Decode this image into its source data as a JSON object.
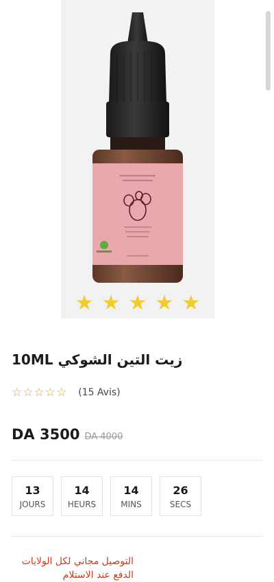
{
  "product": {
    "title": "زيت التين الشوكي 10ML",
    "rating_count": "(15 Avis)",
    "rating_stars": "☆☆☆☆☆",
    "price": "DA 3500",
    "old_price": "DA 4000",
    "image_stars": 5
  },
  "countdown": [
    {
      "value": "13",
      "label": "JOURS"
    },
    {
      "value": "14",
      "label": "HEURS"
    },
    {
      "value": "14",
      "label": "MINS"
    },
    {
      "value": "26",
      "label": "SECS"
    }
  ],
  "promo": {
    "line1": "التوصيل مجاني لكل الولايات",
    "line2": "الدفع عند الاستلام"
  },
  "colors": {
    "accent_red": "#d2381b",
    "star_yellow": "#f2cb2c",
    "label_pink": "#e9a7ae"
  }
}
